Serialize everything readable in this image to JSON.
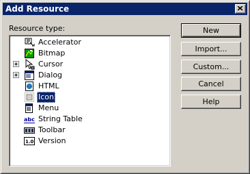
{
  "window": {
    "title": "Add Resource"
  },
  "tree": {
    "label": "Resource type:",
    "items": [
      {
        "label": "Accelerator",
        "icon": "accelerator-icon",
        "expandable": false,
        "selected": false
      },
      {
        "label": "Bitmap",
        "icon": "bitmap-icon",
        "expandable": false,
        "selected": false
      },
      {
        "label": "Cursor",
        "icon": "cursor-icon",
        "expandable": true,
        "selected": false
      },
      {
        "label": "Dialog",
        "icon": "dialog-icon",
        "expandable": true,
        "selected": false
      },
      {
        "label": "HTML",
        "icon": "html-icon",
        "expandable": false,
        "selected": false
      },
      {
        "label": "Icon",
        "icon": "icon-resource-icon",
        "expandable": false,
        "selected": true
      },
      {
        "label": "Menu",
        "icon": "menu-icon",
        "expandable": false,
        "selected": false
      },
      {
        "label": "String Table",
        "icon": "string-table-icon",
        "icon_text": "abc",
        "expandable": false,
        "selected": false
      },
      {
        "label": "Toolbar",
        "icon": "toolbar-icon",
        "expandable": false,
        "selected": false
      },
      {
        "label": "Version",
        "icon": "version-icon",
        "icon_text": "1.0",
        "expandable": false,
        "selected": false
      }
    ]
  },
  "buttons": {
    "new": "New",
    "import": "Import...",
    "custom": "Custom...",
    "cancel": "Cancel",
    "help": "Help"
  },
  "colors": {
    "title_bar": "#0a246a",
    "face": "#d4d0c8",
    "selection": "#0a246a"
  }
}
